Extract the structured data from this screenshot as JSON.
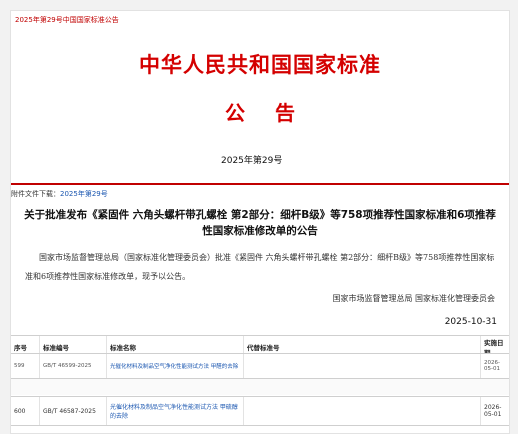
{
  "breadcrumb": "2025年第29号中国国家标准公告",
  "header": {
    "title": "中华人民共和国国家标准",
    "notice": "公告",
    "issue_number": "2025年第29号"
  },
  "attachment": {
    "label": "附件文件下载：",
    "link_text": "2025年第29号"
  },
  "announcement": {
    "title": "关于批准发布《紧固件 六角头螺杆带孔螺栓 第2部分：细杆B级》等758项推荐性国家标准和6项推荐性国家标准修改单的公告",
    "body": "国家市场监督管理总局（国家标准化管理委员会）批准《紧固件 六角头螺杆带孔螺栓 第2部分：细杆B级》等758项推荐性国家标准和6项推荐性国家标准修改单，现予以公告。",
    "signer": "国家市场监督管理总局 国家标准化管理委员会",
    "date": "2025-10-31"
  },
  "table": {
    "headers": [
      "序号",
      "标准编号",
      "标准名称",
      "代替标准号",
      "实施日期"
    ],
    "rows": [
      {
        "no": "599",
        "code": "GB/T 46599-2025",
        "name": "光催化材料及制品空气净化性能测试方法 甲醛的去除",
        "replaces": "",
        "date": "2026-05-01"
      },
      {
        "no": "600",
        "code": "GB/T 46587-2025",
        "name": "光催化材料及制品空气净化性能测试方法 甲硫醇的去除",
        "replaces": "",
        "date": "2026-05-01"
      }
    ]
  }
}
